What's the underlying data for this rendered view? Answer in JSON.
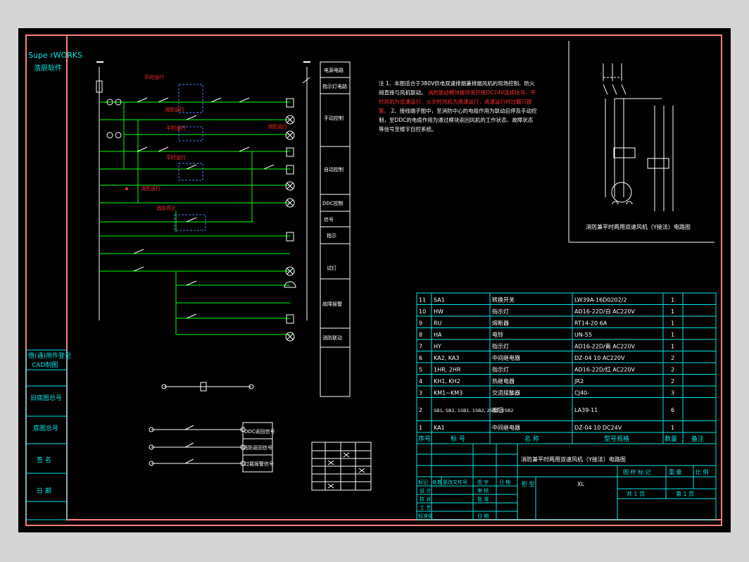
{
  "branding": {
    "line1": "Supe rWORKS",
    "line2": "浩辰软件"
  },
  "title_block_left": [
    "借(通)用件登记",
    "CAD制图",
    "旧底图总号",
    "底图总号",
    "签 名",
    "日 期"
  ],
  "function_column": [
    "电源电路",
    "指示灯电路",
    "手动控制",
    "自动控制",
    "DDC控制",
    "信号",
    "指示",
    "故障报警",
    "试灯",
    "消防联动"
  ],
  "notes": {
    "line1": "注  1、本图适合于380V供电双速排烟兼排烟风机的现场控制、防火阀直接与风机联动。",
    "line2": "消防联动模块提供常开接DC24V连续信号，平时风机为低速运行，火灾时风机为高速运行，高速运行时过载只报警。",
    "line3": "2、接线端子图中，至消防中心的电缆作用为联动启停及手动控制，至DDC的电缆作用为通过模块返回风机的工作状态、故障状态等信号至楼宇自控系统。"
  },
  "bom": {
    "header": {
      "no": "序号",
      "symbol": "标 号",
      "name": "名 称",
      "model": "型号规格",
      "qty": "数量",
      "remark": "备注"
    },
    "rows": [
      {
        "no": "11",
        "symbol": "SA1",
        "name": "转换开关",
        "model": "LW39A-16D0202/2",
        "qty": "1"
      },
      {
        "no": "10",
        "symbol": "HW",
        "name": "指示灯",
        "model": "AD16-22D/白 AC220V",
        "qty": "1"
      },
      {
        "no": "9",
        "symbol": "RU",
        "name": "熔断器",
        "model": "RT14-20 6A",
        "qty": "1"
      },
      {
        "no": "8",
        "symbol": "HA",
        "name": "电铃",
        "model": "UN-55",
        "qty": "1"
      },
      {
        "no": "7",
        "symbol": "HY",
        "name": "指示灯",
        "model": "AD16-22D/黄 AC220V",
        "qty": "1"
      },
      {
        "no": "6",
        "symbol": "KA2, KA3",
        "name": "中间继电器",
        "model": "DZ-04 10 AC220V",
        "qty": "2"
      },
      {
        "no": "5",
        "symbol": "1HR, 2HR",
        "name": "指示灯",
        "model": "AD16-22D/红 AC220V",
        "qty": "2"
      },
      {
        "no": "4",
        "symbol": "KH1, KH2",
        "name": "热继电器",
        "model": "JR2",
        "qty": "2"
      },
      {
        "no": "3",
        "symbol": "KM1~KM3",
        "name": "交流接触器",
        "model": "CJ40-",
        "qty": "3"
      },
      {
        "no": "2",
        "symbol": "SB1, SB2, 1SB1, 1SB2, 2SB1, 2SB2",
        "name": "按钮",
        "model": "LA39-11",
        "qty": "6"
      },
      {
        "no": "1",
        "symbol": "KA1",
        "name": "中间继电器",
        "model": "DZ-04 10 DC24V",
        "qty": "1"
      }
    ]
  },
  "main_circuit_caption": "消防兼平时两用双速风机（Y接法）电路图",
  "title_block": {
    "drawing_title": "消防兼平时两用双速风机（Y接法）电路图",
    "rev_headers": [
      "标记",
      "处数",
      "更改文件号",
      "签 字",
      "日 期"
    ],
    "signoff": [
      "设 计",
      "校 对",
      "工 艺",
      "标准化"
    ],
    "approve": [
      "审 核",
      "批 准",
      "日 期"
    ],
    "type_label": "柜 型",
    "type_value": "XL",
    "stage_labels": [
      "图 样 标 记",
      "重 量",
      "比 例"
    ],
    "sheets_total": "共 1 页",
    "sheet_no": "第 1 页"
  },
  "ddc_terminals": [
    "DDC返回信号",
    "消防返回信号",
    "过载报警信号"
  ],
  "red_labels": [
    "平时运行",
    "消防运行",
    "平时运行",
    "平时运行",
    "消防运行",
    "消防运行",
    "消防停止"
  ],
  "colors": {
    "background": "#000000",
    "cyan": "#00e5e5",
    "green": "#00ff00",
    "red": "#ff3030",
    "yellow": "#ffff00",
    "frame": "#ff8080"
  }
}
